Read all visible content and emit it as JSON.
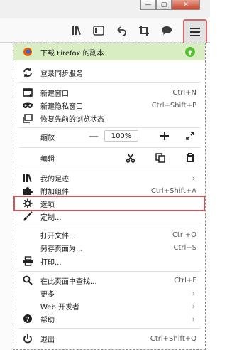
{
  "menu": {
    "banner": {
      "label": "下载 Firefox 的副本"
    },
    "items": [
      {
        "label": "登录同步服务"
      },
      {
        "label": "新建窗口",
        "shortcut": "Ctrl+N"
      },
      {
        "label": "新建隐私窗口",
        "shortcut": "Ctrl+Shift+P"
      },
      {
        "label": "恢复先前的浏览状态"
      },
      {
        "label": "缩放",
        "zoom_value": "100%"
      },
      {
        "label": "编辑"
      },
      {
        "label": "我的足迹"
      },
      {
        "label": "附加组件",
        "shortcut": "Ctrl+Shift+A"
      },
      {
        "label": "选项"
      },
      {
        "label": "定制..."
      },
      {
        "label": "打开文件...",
        "shortcut": "Ctrl+O"
      },
      {
        "label": "另存页面为...",
        "shortcut": "Ctrl+S"
      },
      {
        "label": "打印..."
      },
      {
        "label": "在此页面中查找...",
        "shortcut": "Ctrl+F"
      },
      {
        "label": "更多"
      },
      {
        "label": "Web 开发者"
      },
      {
        "label": "帮助"
      },
      {
        "label": "退出",
        "shortcut": "Ctrl+Shift+Q"
      }
    ]
  },
  "colors": {
    "banner_bg": "#d8eec2",
    "highlight_border": "#c95a5c",
    "firefox_orange": "#e66000",
    "update_green": "#57bd35"
  },
  "icons": [
    "library-icon",
    "sidebar-icon",
    "back-arrow-icon",
    "crop-icon",
    "chat-icon",
    "hamburger-menu-icon",
    "firefox-logo-icon",
    "update-arrow-icon",
    "sync-icon",
    "new-window-icon",
    "private-mask-icon",
    "restore-icon",
    "zoom-out-icon",
    "zoom-in-icon",
    "fullscreen-icon",
    "cut-icon",
    "copy-icon",
    "paste-icon",
    "library-icon",
    "puzzle-icon",
    "gear-icon",
    "brush-icon",
    "print-icon",
    "search-icon",
    "power-icon"
  ]
}
